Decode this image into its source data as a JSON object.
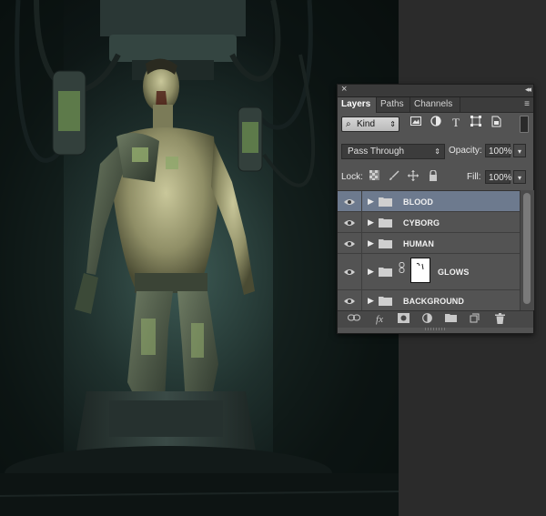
{
  "panel": {
    "close_glyph": "×",
    "collapse_glyph": "◂◂",
    "menu_glyph": "≡"
  },
  "tabs": [
    {
      "label": "Layers",
      "active": true
    },
    {
      "label": "Paths",
      "active": false
    },
    {
      "label": "Channels",
      "active": false
    }
  ],
  "filter": {
    "kind_label": "Kind",
    "icons": [
      "image-filter-icon",
      "adjustment-filter-icon",
      "type-filter-icon",
      "shape-filter-icon",
      "smart-object-filter-icon"
    ]
  },
  "blend": {
    "mode": "Pass Through",
    "opacity_label": "Opacity:",
    "opacity_value": "100%"
  },
  "lock": {
    "label": "Lock:",
    "icons": [
      "lock-transparent-icon",
      "lock-image-icon",
      "lock-position-icon",
      "lock-all-icon"
    ],
    "fill_label": "Fill:",
    "fill_value": "100%"
  },
  "layers": [
    {
      "name": "BLOOD",
      "selected": true,
      "has_mask": false
    },
    {
      "name": "CYBORG",
      "selected": false,
      "has_mask": false
    },
    {
      "name": "HUMAN",
      "selected": false,
      "has_mask": false
    },
    {
      "name": "GLOWS",
      "selected": false,
      "has_mask": true
    },
    {
      "name": "BACKGROUND",
      "selected": false,
      "has_mask": false
    }
  ],
  "bottom_tools": [
    "link-layers-icon",
    "fx-icon",
    "add-mask-icon",
    "adjustment-layer-icon",
    "new-group-icon",
    "new-layer-icon",
    "trash-icon"
  ],
  "bottom_tools_text": {
    "fx": "fx"
  },
  "colors": {
    "panel_bg": "#535353",
    "selected_row": "#6d7a8e",
    "artwork_glow": "#3d5a54"
  }
}
